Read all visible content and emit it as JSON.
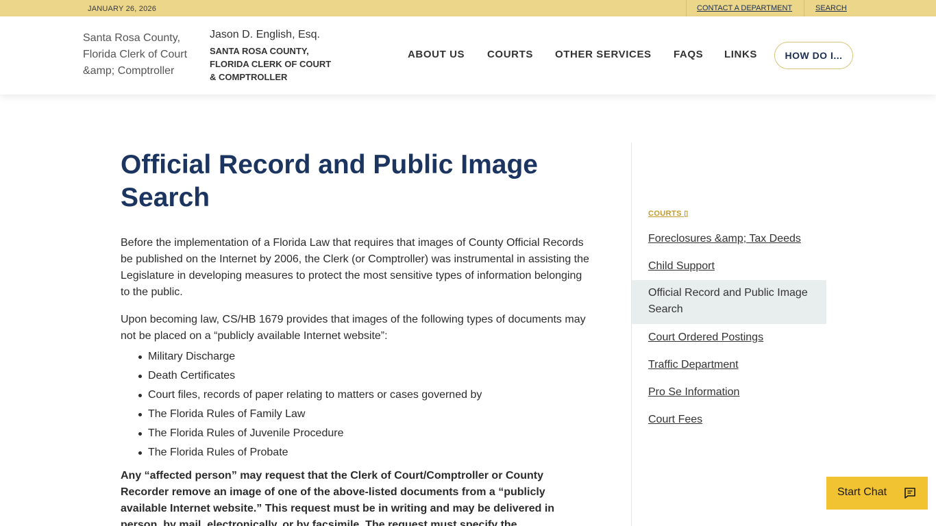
{
  "topbar": {
    "date": "JANUARY 26, 2026",
    "contact_label": "CONTACT A DEPARTMENT",
    "search_label": "SEARCH"
  },
  "header": {
    "logo_alt": "Santa Rosa County, Florida Clerk of Court &amp; Comptroller",
    "clerk_name": "Jason D. English, Esq.",
    "org_name": "SANTA ROSA COUNTY, FLORIDA CLERK OF COURT & COMPTROLLER",
    "nav": [
      "ABOUT US",
      "COURTS",
      "OTHER SERVICES",
      "FAQS",
      "LINKS"
    ],
    "how_do_label": "HOW DO I..."
  },
  "main": {
    "title": "Official Record and Public Image Search",
    "para1": "Before the implementation of a Florida Law that requires that images of County Official Records be published on the Internet by 2006, the Clerk (or Comptroller) was instrumental in assisting the Legislature in developing measures to protect the most sensitive types of information belonging to the public.",
    "para2": "Upon becoming law, CS/HB 1679 provides that images of the following types of documents may not be placed on a “publicly available Internet website”:",
    "bullets": [
      "Military Discharge",
      "Death Certificates",
      "Court files, records of paper relating to matters or cases governed by",
      "The Florida Rules of Family Law",
      "The Florida Rules of Juvenile Procedure",
      "The Florida Rules of Probate"
    ],
    "para3": "Any “affected person” may request that the Clerk of Court/Comptroller or County Recorder remove an image of one of the above-listed documents from a “publicly available Internet website.” This request must be in writing and may be delivered in person, by mail, electronically, or by facsimile. The request must specify the"
  },
  "sidebar": {
    "heading": "COURTS ▯",
    "links": [
      "Foreclosures &amp; Tax Deeds",
      "Child Support",
      "Official Record and Public Image Search",
      "Court Ordered Postings",
      "Traffic Department",
      "Pro Se Information",
      "Court Fees"
    ]
  },
  "chat": {
    "label": "Start Chat",
    "icon": "chat-bubble-icon"
  },
  "colors": {
    "topbar": "#ecd689",
    "title": "#1c3560",
    "accent": "#c49a2b",
    "chat": "#f1c232"
  }
}
